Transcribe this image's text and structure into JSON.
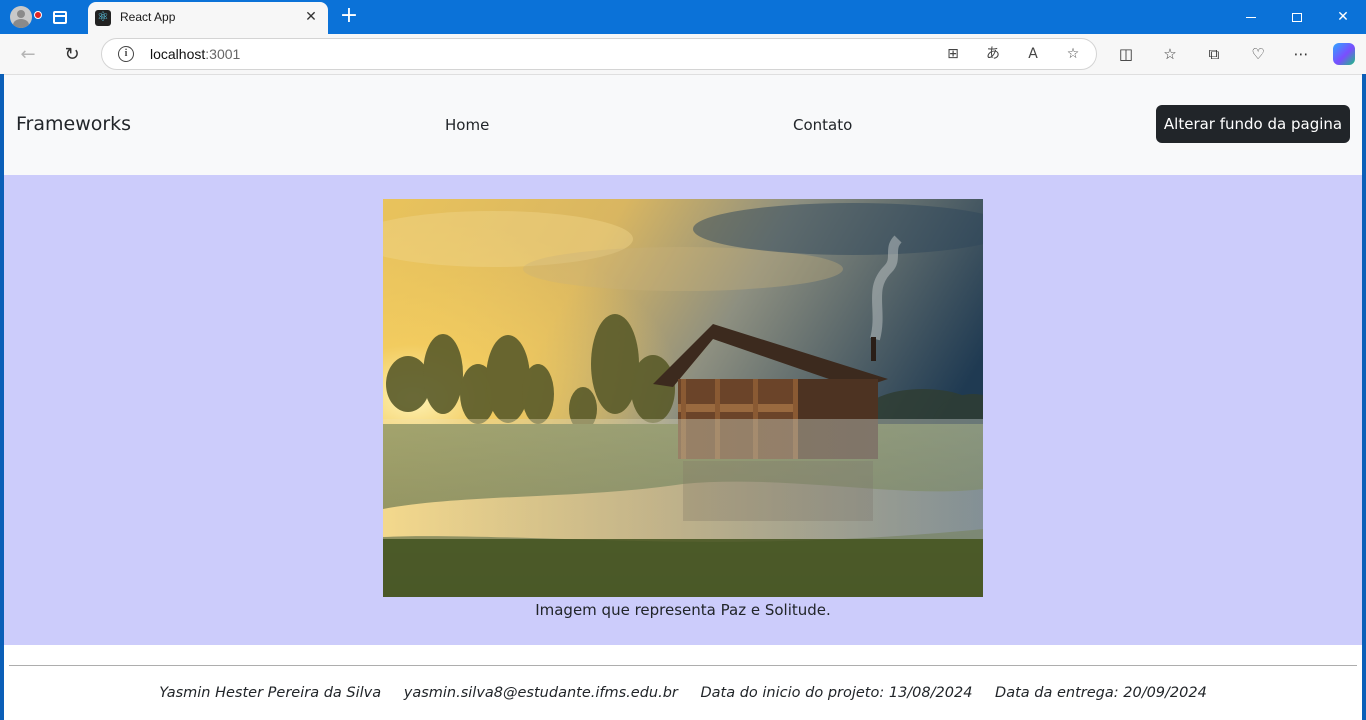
{
  "browser": {
    "tab_title": "React App",
    "url_host": "localhost",
    "url_port": ":3001"
  },
  "navbar": {
    "brand": "Frameworks",
    "links": [
      "Home",
      "Contato"
    ],
    "button_label": "Alterar fundo da pagina"
  },
  "hero": {
    "caption": "Imagem que representa Paz e Solitude.",
    "background_color": "#ccccfb"
  },
  "footer": {
    "name": "Yasmin Hester Pereira da Silva",
    "email": "yasmin.silva8@estudante.ifms.edu.br",
    "start_date": "Data do inicio do projeto: 13/08/2024",
    "due_date": "Data da entrega: 20/09/2024"
  },
  "colors": {
    "browser_accent": "#0b72d8",
    "button_dark": "#212529",
    "navbar_bg": "#f8f9fa"
  },
  "icons": [
    "profile-icon",
    "workspaces-icon",
    "react-favicon",
    "close-icon",
    "new-tab-icon",
    "back-icon",
    "reload-icon",
    "info-icon",
    "app-available-icon",
    "translate-icon",
    "read-aloud-icon",
    "favorite-star-icon",
    "split-screen-icon",
    "favorites-icon",
    "collections-icon",
    "browser-essentials-icon",
    "more-icon",
    "copilot-icon"
  ]
}
